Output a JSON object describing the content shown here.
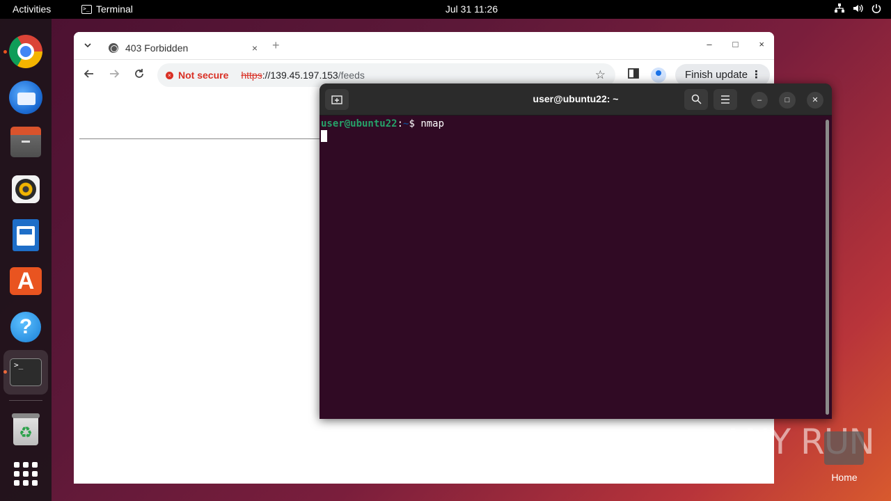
{
  "topbar": {
    "activities": "Activities",
    "app_name": "Terminal",
    "app_icon": "terminal-icon",
    "clock": "Jul 31  11:26",
    "tray_icons": [
      "network-icon",
      "volume-icon",
      "power-icon"
    ]
  },
  "dock": {
    "items": [
      {
        "name": "Google Chrome",
        "icon": "chrome-icon",
        "running": true
      },
      {
        "name": "Thunderbird Mail",
        "icon": "thunderbird-icon",
        "running": false
      },
      {
        "name": "Files",
        "icon": "files-icon",
        "running": false
      },
      {
        "name": "Rhythmbox",
        "icon": "rhythmbox-icon",
        "running": false
      },
      {
        "name": "LibreOffice Writer",
        "icon": "libreoffice-writer-icon",
        "running": false
      },
      {
        "name": "Ubuntu Software",
        "icon": "ubuntu-software-icon",
        "running": false
      },
      {
        "name": "Help",
        "icon": "help-icon",
        "running": false
      },
      {
        "name": "Terminal",
        "icon": "terminal-icon",
        "running": true
      },
      {
        "name": "Trash",
        "icon": "trash-icon",
        "running": false
      },
      {
        "name": "Show Applications",
        "icon": "app-grid-icon",
        "running": false
      }
    ],
    "terminal_glyph": ">_",
    "store_glyph": "A",
    "help_glyph": "?",
    "trash_glyph": "♻"
  },
  "browser": {
    "tab_title": "403 Forbidden",
    "tab_close": "×",
    "new_tab": "+",
    "omnibox": {
      "security_label": "Not secure",
      "scheme": "https",
      "host": "://139.45.197.153",
      "path": "/feeds"
    },
    "update_button": "Finish update",
    "update_menu": "⋮",
    "window_controls": [
      "–",
      "□",
      "×"
    ]
  },
  "terminal": {
    "title": "user@ubuntu22: ~",
    "prompt_user": "user@ubuntu22",
    "prompt_sep": ":",
    "prompt_path": "~",
    "prompt_symbol": "$ ",
    "command": "nmap"
  },
  "desktop": {
    "home_label": "Home",
    "watermark": "ANY RUN"
  },
  "colors": {
    "ubuntu_orange": "#e95420",
    "terminal_bg": "#300a24",
    "prompt_user": "#26a269",
    "prompt_path": "#12488b",
    "not_secure_red": "#d93025"
  }
}
